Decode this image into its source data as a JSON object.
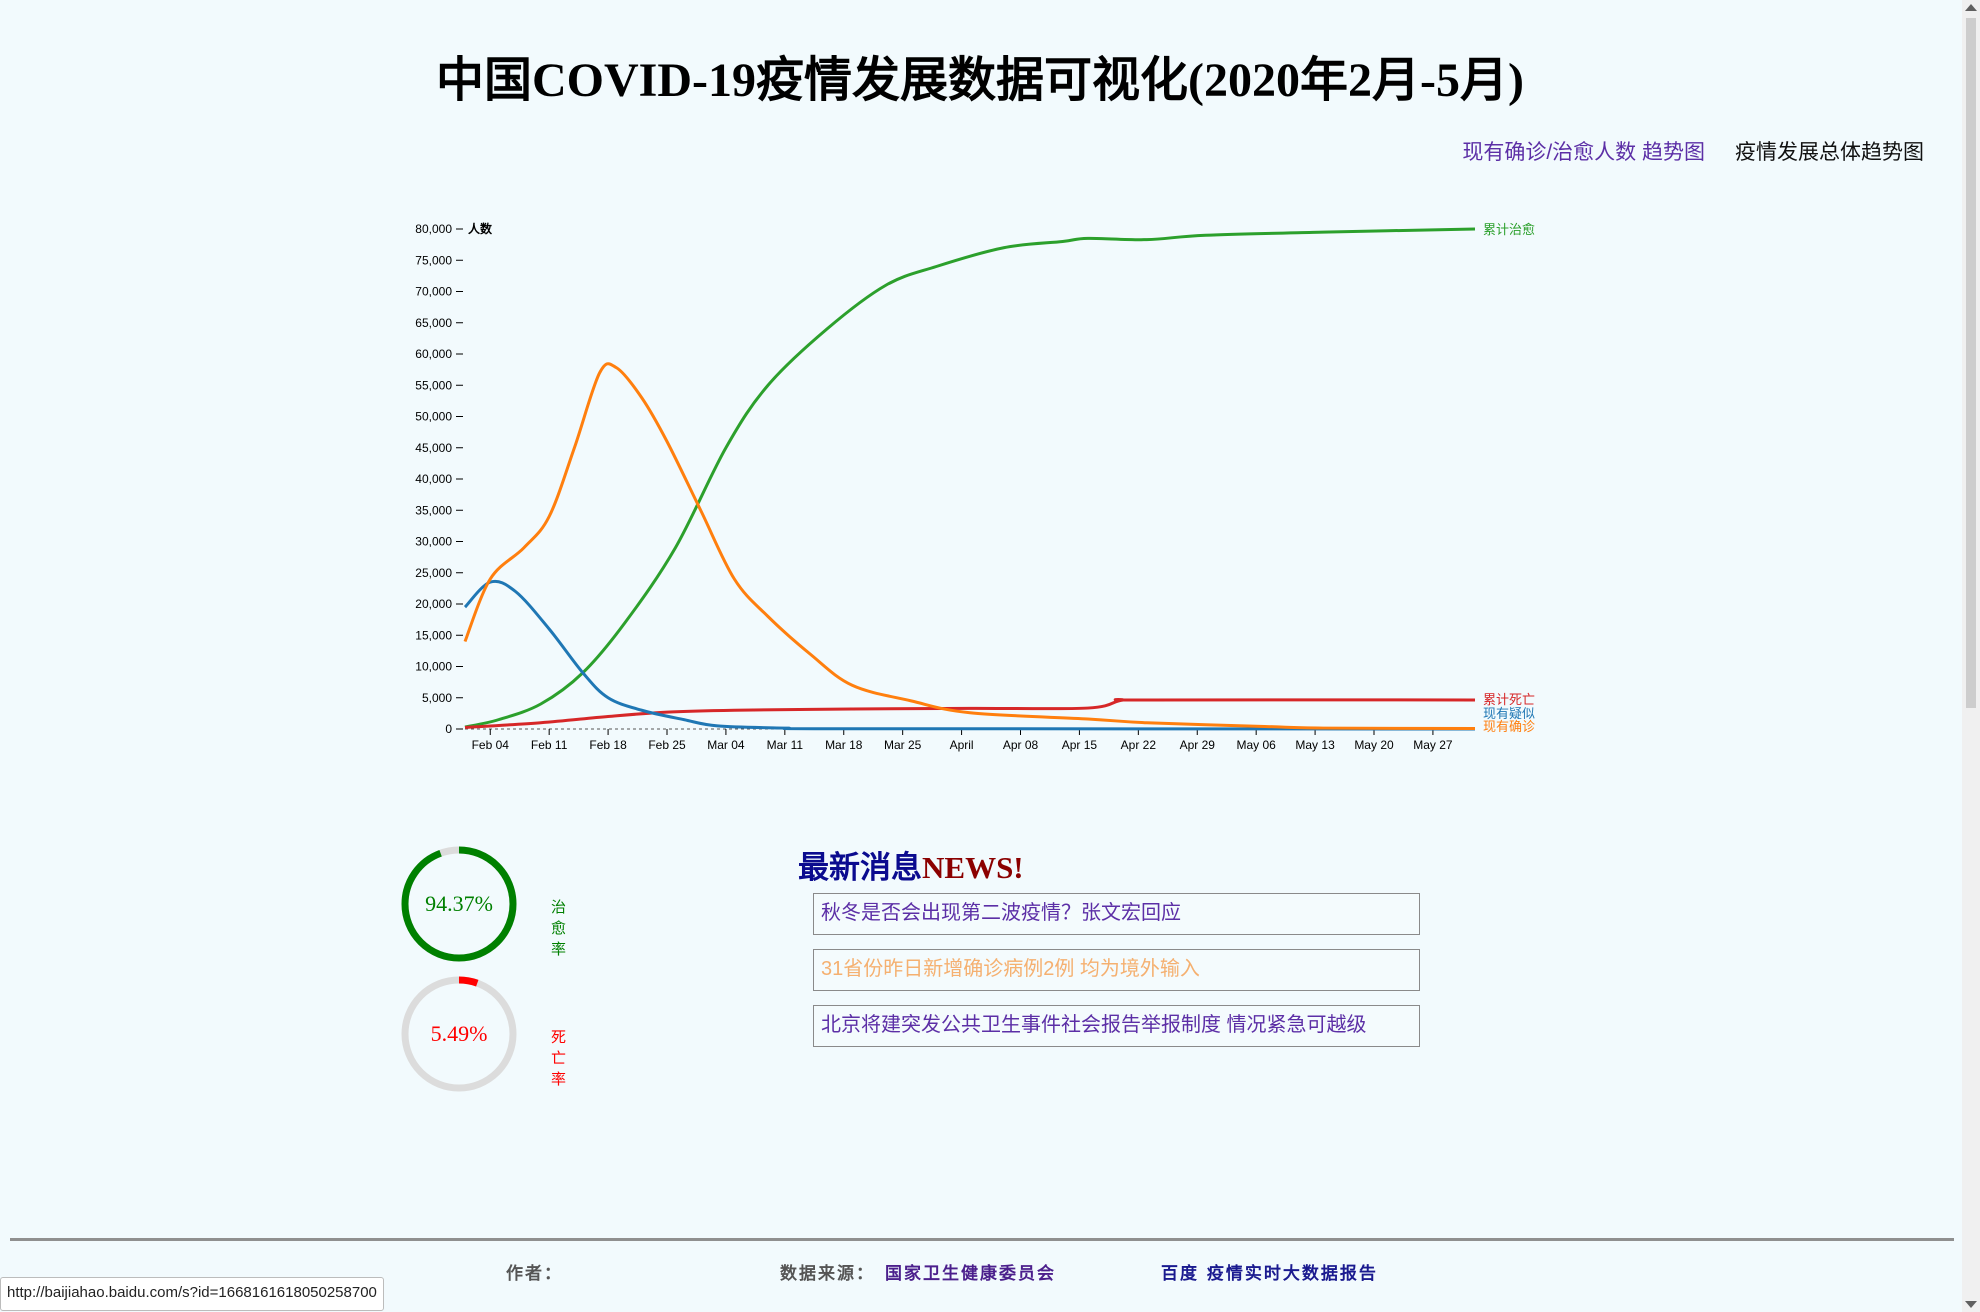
{
  "page": {
    "title": "中国COVID-19疫情发展数据可视化(2020年2月-5月)"
  },
  "nav": {
    "trend_link": "现有确诊/治愈人数 趋势图",
    "overall_link": "疫情发展总体趋势图"
  },
  "chart_data": {
    "type": "line",
    "ylabel": "人数",
    "ylim": [
      0,
      80000
    ],
    "y_ticks": [
      "0",
      "5,000",
      "10,000",
      "15,000",
      "20,000",
      "25,000",
      "30,000",
      "35,000",
      "40,000",
      "45,000",
      "50,000",
      "55,000",
      "60,000",
      "65,000",
      "70,000",
      "75,000",
      "80,000"
    ],
    "x_ticks": [
      "Feb 04",
      "Feb 11",
      "Feb 18",
      "Feb 25",
      "Mar 04",
      "Mar 11",
      "Mar 18",
      "Mar 25",
      "April",
      "Apr 08",
      "Apr 15",
      "Apr 22",
      "Apr 29",
      "May 06",
      "May 13",
      "May 20",
      "May 27"
    ],
    "x_start": "2020-02-01",
    "x_end": "2020-05-31",
    "grid": false,
    "series": [
      {
        "name": "累计治愈",
        "color": "#2ca02c",
        "points": [
          [
            "2020-02-01",
            300
          ],
          [
            "2020-02-05",
            1500
          ],
          [
            "2020-02-10",
            4000
          ],
          [
            "2020-02-15",
            9000
          ],
          [
            "2020-02-20",
            17000
          ],
          [
            "2020-02-26",
            29000
          ],
          [
            "2020-03-03",
            45000
          ],
          [
            "2020-03-08",
            55000
          ],
          [
            "2020-03-15",
            64000
          ],
          [
            "2020-03-22",
            71000
          ],
          [
            "2020-03-28",
            74000
          ],
          [
            "2020-04-05",
            77000
          ],
          [
            "2020-04-12",
            78000
          ],
          [
            "2020-04-15",
            78500
          ],
          [
            "2020-04-22",
            78300
          ],
          [
            "2020-04-29",
            79000
          ],
          [
            "2020-05-13",
            79500
          ],
          [
            "2020-05-31",
            80000
          ]
        ]
      },
      {
        "name": "累计死亡",
        "color": "#d62728",
        "points": [
          [
            "2020-02-01",
            250
          ],
          [
            "2020-02-10",
            1000
          ],
          [
            "2020-02-18",
            2000
          ],
          [
            "2020-02-25",
            2700
          ],
          [
            "2020-03-04",
            3000
          ],
          [
            "2020-03-18",
            3200
          ],
          [
            "2020-04-01",
            3300
          ],
          [
            "2020-04-15",
            3350
          ],
          [
            "2020-04-19",
            4600
          ],
          [
            "2020-04-22",
            4650
          ],
          [
            "2020-05-31",
            4650
          ]
        ]
      },
      {
        "name": "现有疑似",
        "color": "#1f77b4",
        "points": [
          [
            "2020-02-01",
            19500
          ],
          [
            "2020-02-04",
            23500
          ],
          [
            "2020-02-07",
            22000
          ],
          [
            "2020-02-11",
            16000
          ],
          [
            "2020-02-15",
            9000
          ],
          [
            "2020-02-18",
            5000
          ],
          [
            "2020-02-22",
            3000
          ],
          [
            "2020-02-27",
            1500
          ],
          [
            "2020-03-02",
            500
          ],
          [
            "2020-03-10",
            150
          ],
          [
            "2020-03-18",
            50
          ],
          [
            "2020-05-31",
            0
          ]
        ]
      },
      {
        "name": "现有确诊",
        "color": "#ff7f0e",
        "points": [
          [
            "2020-02-01",
            14000
          ],
          [
            "2020-02-04",
            24000
          ],
          [
            "2020-02-08",
            29000
          ],
          [
            "2020-02-11",
            34000
          ],
          [
            "2020-02-14",
            45000
          ],
          [
            "2020-02-17",
            57000
          ],
          [
            "2020-02-19",
            57800
          ],
          [
            "2020-02-22",
            53000
          ],
          [
            "2020-02-25",
            46000
          ],
          [
            "2020-02-29",
            35000
          ],
          [
            "2020-03-04",
            24000
          ],
          [
            "2020-03-08",
            18000
          ],
          [
            "2020-03-13",
            12000
          ],
          [
            "2020-03-18",
            7000
          ],
          [
            "2020-03-25",
            4500
          ],
          [
            "2020-04-01",
            2600
          ],
          [
            "2020-04-15",
            1600
          ],
          [
            "2020-04-22",
            1000
          ],
          [
            "2020-05-06",
            400
          ],
          [
            "2020-05-13",
            150
          ],
          [
            "2020-05-31",
            80
          ]
        ]
      }
    ]
  },
  "gauges": [
    {
      "label": "治愈率",
      "value_text": "94.37%",
      "percent": 94.37,
      "color": "#008000"
    },
    {
      "label": "死亡率",
      "value_text": "5.49%",
      "percent": 5.49,
      "color": "#ff0000"
    }
  ],
  "news": {
    "title_cn": "最新消息",
    "title_en": "NEWS!",
    "items": [
      {
        "text": "秋冬是否会出现第二波疫情？张文宏回应",
        "color": "#5c2fa6"
      },
      {
        "text": "31省份昨日新增确诊病例2例 均为境外输入",
        "color": "#f5b070"
      },
      {
        "text": "北京将建突发公共卫生事件社会报告举报制度 情况紧急可越级",
        "color": "#5c2fa6"
      }
    ]
  },
  "footer": {
    "author_label": "作者：",
    "source_label": "数据来源：",
    "source_link": "国家卫生健康委员会",
    "baidu_link": "百度 疫情实时大数据报告"
  },
  "status_url": "http://baijiahao.baidu.com/s?id=1668161618050258700"
}
